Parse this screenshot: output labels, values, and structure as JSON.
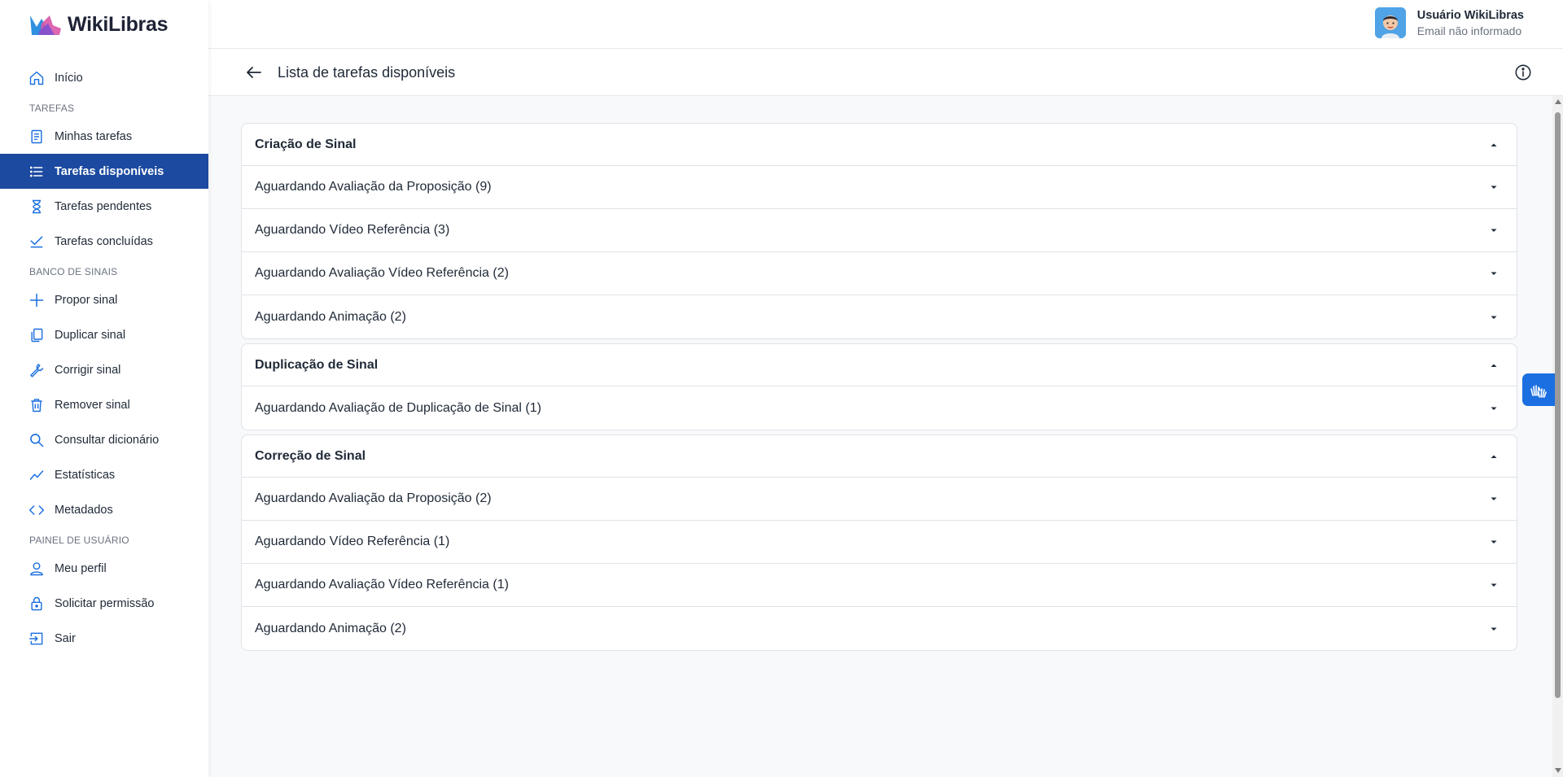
{
  "brand": {
    "name": "WikiLibras",
    "colors": {
      "primary": "#1b4aa0",
      "logo_blue": "#2f8fe0",
      "logo_pink": "#d957a8"
    }
  },
  "sidebar": {
    "home": {
      "label": "Início",
      "icon": "home-icon"
    },
    "sections": {
      "tasks": "TAREFAS",
      "signs": "BANCO DE SINAIS",
      "user": "PAINEL DE USUÁRIO"
    },
    "items": {
      "my_tasks": "Minhas tarefas",
      "available_tasks": "Tarefas disponíveis",
      "pending_tasks": "Tarefas pendentes",
      "completed_tasks": "Tarefas concluídas",
      "propose_sign": "Propor sinal",
      "duplicate_sign": "Duplicar sinal",
      "correct_sign": "Corrigir sinal",
      "remove_sign": "Remover sinal",
      "dictionary": "Consultar dicionário",
      "statistics": "Estatísticas",
      "metadata": "Metadados",
      "profile": "Meu perfil",
      "permission": "Solicitar permissão",
      "logout": "Sair"
    }
  },
  "user": {
    "name": "Usuário WikiLibras",
    "email": "Email não informado"
  },
  "page": {
    "title": "Lista de tarefas disponíveis"
  },
  "groups": [
    {
      "title": "Criação de Sinal",
      "rows": [
        "Aguardando Avaliação da Proposição (9)",
        "Aguardando Vídeo Referência (3)",
        "Aguardando Avaliação Vídeo Referência (2)",
        "Aguardando Animação (2)"
      ]
    },
    {
      "title": "Duplicação de Sinal",
      "rows": [
        "Aguardando Avaliação de Duplicação de Sinal (1)"
      ]
    },
    {
      "title": "Correção de Sinal",
      "rows": [
        "Aguardando Avaliação da Proposição (2)",
        "Aguardando Vídeo Referência (1)",
        "Aguardando Avaliação Vídeo Referência (1)",
        "Aguardando Animação (2)"
      ]
    }
  ]
}
